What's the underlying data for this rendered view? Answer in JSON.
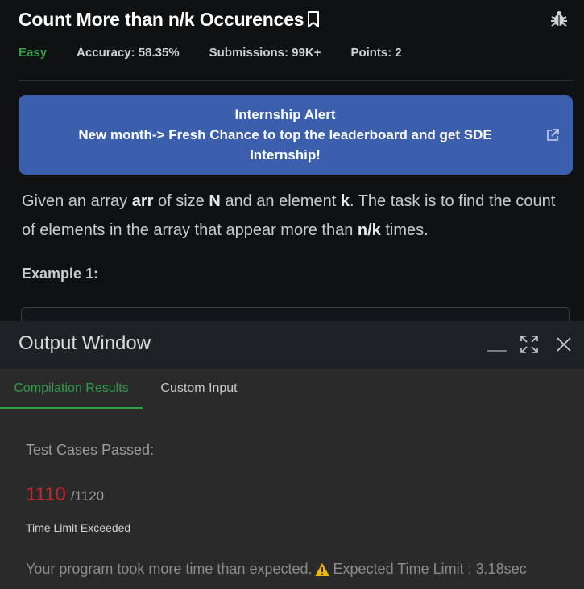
{
  "problem": {
    "title": "Count More than n/k Occurences",
    "difficulty": "Easy",
    "accuracy": "Accuracy: 58.35%",
    "submissions": "Submissions: 99K+",
    "points": "Points: 2",
    "alert": {
      "line1": "Internship Alert",
      "line2": "New month-> Fresh Chance to top the leaderboard and get SDE Internship!"
    },
    "description": {
      "p1": "Given an array ",
      "b1": "arr",
      "p2": " of size ",
      "b2": "N",
      "p3": " and an element ",
      "b3": "k",
      "p4": ". The task is to find the count of elements in the array that appear more than ",
      "b4": "n/k",
      "p5": " times."
    },
    "example_title": "Example 1:"
  },
  "output_window": {
    "title": "Output Window",
    "tabs": [
      "Compilation Results",
      "Custom Input"
    ],
    "active_tab": "Compilation Results",
    "test_cases_label": "Test Cases Passed:",
    "passed": "1110",
    "total": "/1120",
    "status": "Time Limit Exceeded",
    "message": "Your program took more time than expected.",
    "expected_limit": "Expected Time Limit : 3.18sec"
  },
  "colors": {
    "accent_green": "#2f9e47",
    "alert_blue": "#3b5fad",
    "error_red": "#c0272d",
    "warning_yellow": "#f2b705"
  },
  "icons": [
    "bookmark-icon",
    "bug-icon",
    "external-link-icon",
    "minimize-icon",
    "expand-icon",
    "close-icon",
    "warning-icon"
  ]
}
